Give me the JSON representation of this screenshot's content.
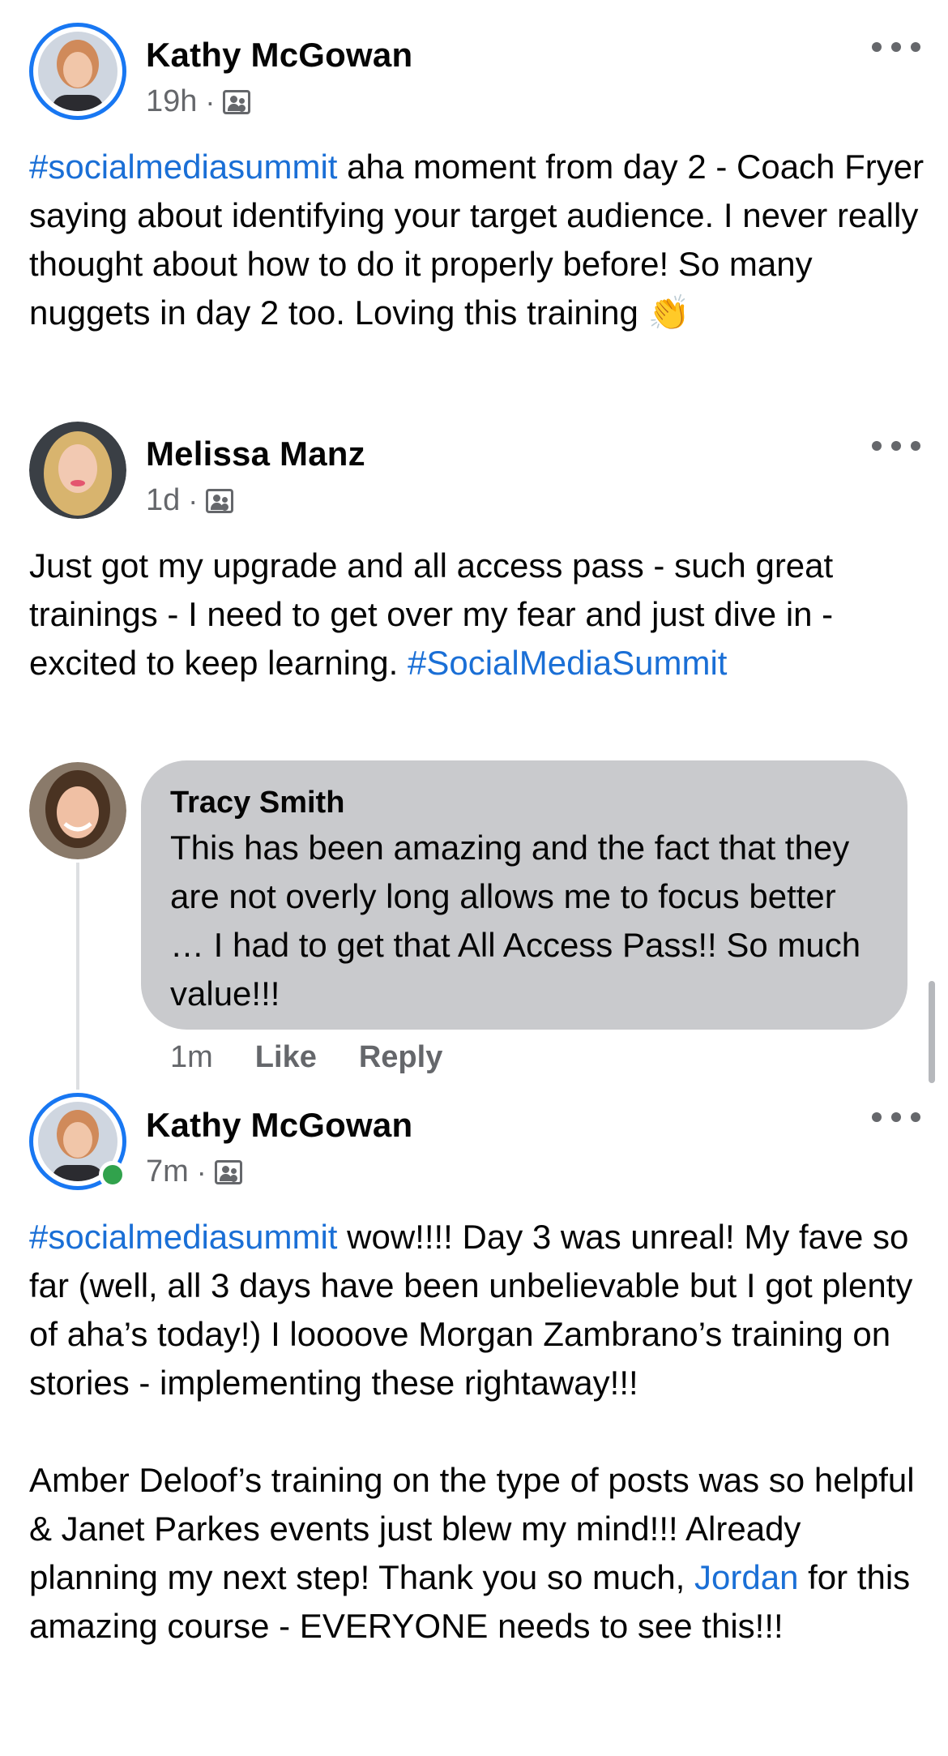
{
  "posts": [
    {
      "author": "Kathy McGowan",
      "time": "19h",
      "hashtag": "#socialmediasummit",
      "text": " aha moment from day 2 - Coach Fryer saying about identifying your target audience. I never really thought about how to do it properly before! So many nuggets in day 2 too. Loving this training 👏"
    },
    {
      "author": "Melissa Manz",
      "time": "1d",
      "text": "Just got my upgrade and all access pass - such great trainings - I need to get over my fear and just dive in - excited to keep learning. ",
      "hashtag": "#SocialMediaSummit"
    },
    {
      "author": "Kathy McGowan",
      "time": "7m",
      "hashtag": "#socialmediasummit",
      "text_a": " wow!!!! Day 3 was unreal! My fave so far (well, all 3 days have been unbelievable but I got plenty of aha’s today!) I loooove Morgan Zambrano’s training on stories - implementing these rightaway!!!\n\nAmber Deloof’s training on the type of posts was so helpful & Janet Parkes events just blew my mind!!! Already planning my next step! Thank you so much, ",
      "mention": "Jordan",
      "text_b": " for this amazing course - EVERYONE needs to see this!!!"
    }
  ],
  "comment": {
    "author": "Tracy Smith",
    "text": "This has been amazing and the fact that they are not overly long allows me to focus better … I had to get that All Access Pass!! So much value!!!",
    "time": "1m",
    "like_label": "Like",
    "reply_label": "Reply"
  },
  "meta_separator": "·",
  "colors": {
    "link": "#1a6fd6",
    "bubble": "#c9cacd",
    "online": "#31a24c",
    "ring": "#1877f2"
  }
}
